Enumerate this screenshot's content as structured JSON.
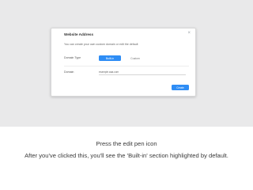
{
  "dialog": {
    "title": "Website Address",
    "instruction": "You can create your own custom domain or edit the default",
    "type_label": "Domain Type",
    "builtin_label": "Built-in",
    "custom_label": "Custom",
    "domain_label": "Domain",
    "domain_value": "example.aaa.com",
    "create_label": "Create"
  },
  "caption": {
    "title": "Press the edit pen icon",
    "body": "After you've clicked this, you'll see the 'Built-in' section highlighted by default."
  },
  "colors": {
    "accent": "#2e8df5",
    "backdrop": "#e9e9ea"
  }
}
